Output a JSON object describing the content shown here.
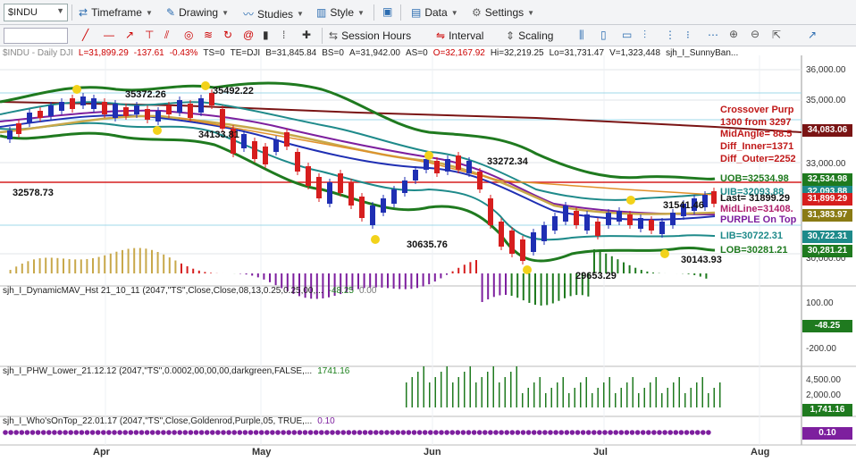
{
  "toolbar": {
    "symbol": "$INDU",
    "timeframe": "Timeframe",
    "drawing": "Drawing",
    "studies": "Studies",
    "style": "Style",
    "data": "Data",
    "settings": "Settings",
    "session_hours": "Session Hours",
    "interval": "Interval",
    "scaling": "Scaling"
  },
  "header": {
    "symbol_desc": "$INDU - Daily  DJI",
    "last": "L=31,899.29",
    "change": "-137.61",
    "pct": "-0.43%",
    "ts": "TS=0",
    "te": "TE=DJI",
    "bid": "B=31,845.84",
    "bs": "BS=0",
    "ask": "A=31,942.00",
    "as": "AS=0",
    "open": "O=32,167.92",
    "high": "Hi=32,219.25",
    "low": "Lo=31,731.47",
    "vol": "V=1,323,448",
    "study": "sjh_I_SunnyBan..."
  },
  "panes": {
    "dmav": {
      "label": "sjh_I_DynamicMAV_Hst 21_10_11 (2047,\"TS\",Close,Close,08,13,0.25,0.25,00,...",
      "v1": "-48.25",
      "v2": "0.00"
    },
    "phw": {
      "label": "sjh_I_PHW_Lower_21.12.12 (2047,\"TS\",0.0002,00,00,00,darkgreen,FALSE,...",
      "v1": "1741.16"
    },
    "who": {
      "label": "sjh_I_Who'sOnTop_22.01.17 (2047,\"TS\",Close,Goldenrod,Purple,05, TRUE,...",
      "v1": "0.10"
    }
  },
  "price_axis": [
    "36,000.00",
    "35,000.00",
    "33,000.00",
    "30,000.00"
  ],
  "price_boxes": [
    {
      "text": "34,083.06",
      "color": "#7a1414"
    },
    {
      "text": "32,534.98",
      "color": "#1f7a1f"
    },
    {
      "text": "32,093.88",
      "color": "#1e8a8a"
    },
    {
      "text": "31,899.29",
      "color": "#d61e1e"
    },
    {
      "text": "31,383.97",
      "color": "#8a7b14"
    },
    {
      "text": "30,722.31",
      "color": "#1e8a8a"
    },
    {
      "text": "30,281.21",
      "color": "#1f7a1f"
    }
  ],
  "osc_axis": {
    "dmav": [
      "100.00",
      "-200.00"
    ],
    "dmav_box": "-48.25",
    "phw": [
      "4,500.00",
      "2,000.00"
    ],
    "phw_box": "1,741.16",
    "who_box": "0.10"
  },
  "annotations": {
    "p35372": "35372.26",
    "p35492": "35492.22",
    "p34": "34133.81",
    "p32578": "32578.73",
    "p33272": "33272.34",
    "p30635": "30635.76",
    "p29653": "29653.29",
    "p31541": "31541.46",
    "p30143": "30143.93"
  },
  "info": {
    "crossover": "Crossover Purp",
    "from": "1300 from 3297",
    "midangle": "MidAngle= 88.5",
    "diff_inner": "Diff_Inner=1371",
    "diff_outer": "Diff_Outer=2252",
    "uob": "UOB=32534.98",
    "uib": "UIB=32093.88",
    "last": "Last= 31899.29",
    "midline": "MidLine=31408.",
    "purple": "PURPLE On Top",
    "lib": "LIB=30722.31",
    "lob": "LOB=30281.21"
  },
  "months": [
    "Apr",
    "May",
    "Jun",
    "Jul",
    "Aug"
  ],
  "colors": {
    "up": "#1f2fb3",
    "down": "#d61e1e",
    "green": "#1f7a1f",
    "teal": "#1e8a8a",
    "maroon": "#7a1414",
    "purple": "#7d1f9e",
    "gold": "#c8a84a"
  }
}
